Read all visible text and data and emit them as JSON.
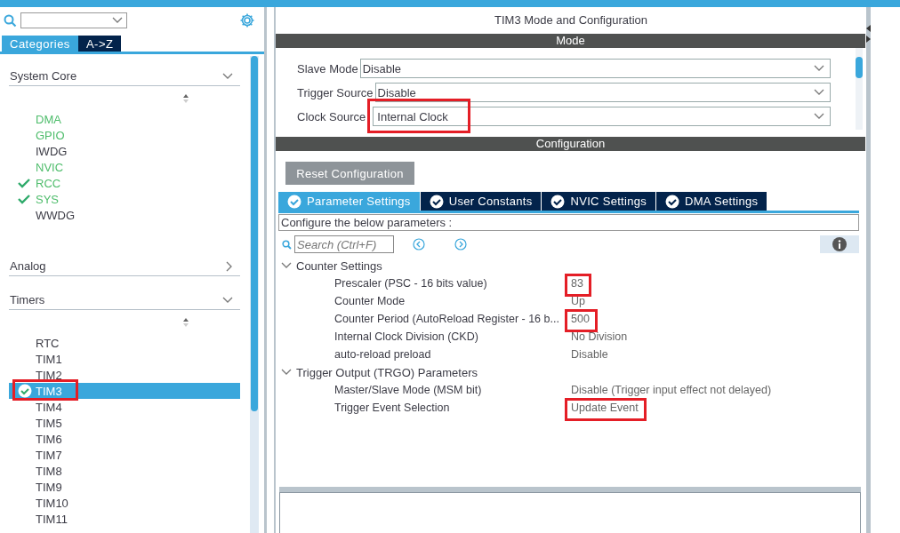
{
  "sidebar": {
    "view_tabs": [
      {
        "label": "Categories",
        "selected": true
      },
      {
        "label": "A->Z",
        "selected": false
      }
    ],
    "groups": [
      {
        "label": "System Core",
        "expanded": true,
        "items": [
          {
            "label": "DMA",
            "configured": true,
            "checked": false,
            "selected": false,
            "highlighted": false
          },
          {
            "label": "GPIO",
            "configured": true,
            "checked": false,
            "selected": false,
            "highlighted": false
          },
          {
            "label": "IWDG",
            "configured": false,
            "checked": false,
            "selected": false,
            "highlighted": false
          },
          {
            "label": "NVIC",
            "configured": true,
            "checked": false,
            "selected": false,
            "highlighted": false
          },
          {
            "label": "RCC",
            "configured": true,
            "checked": true,
            "selected": false,
            "highlighted": false
          },
          {
            "label": "SYS",
            "configured": true,
            "checked": true,
            "selected": false,
            "highlighted": false
          },
          {
            "label": "WWDG",
            "configured": false,
            "checked": false,
            "selected": false,
            "highlighted": false
          }
        ]
      },
      {
        "label": "Analog",
        "expanded": false
      },
      {
        "label": "Timers",
        "expanded": true,
        "items": [
          {
            "label": "RTC",
            "configured": false,
            "checked": false,
            "selected": false,
            "highlighted": false
          },
          {
            "label": "TIM1",
            "configured": false,
            "checked": false,
            "selected": false,
            "highlighted": false
          },
          {
            "label": "TIM2",
            "configured": false,
            "checked": false,
            "selected": false,
            "highlighted": false
          },
          {
            "label": "TIM3",
            "configured": false,
            "checked": true,
            "selected": true,
            "highlighted": true
          },
          {
            "label": "TIM4",
            "configured": false,
            "checked": false,
            "selected": false,
            "highlighted": false
          },
          {
            "label": "TIM5",
            "configured": false,
            "checked": false,
            "selected": false,
            "highlighted": false
          },
          {
            "label": "TIM6",
            "configured": false,
            "checked": false,
            "selected": false,
            "highlighted": false
          },
          {
            "label": "TIM7",
            "configured": false,
            "checked": false,
            "selected": false,
            "highlighted": false
          },
          {
            "label": "TIM8",
            "configured": false,
            "checked": false,
            "selected": false,
            "highlighted": false
          },
          {
            "label": "TIM9",
            "configured": false,
            "checked": false,
            "selected": false,
            "highlighted": false
          },
          {
            "label": "TIM10",
            "configured": false,
            "checked": false,
            "selected": false,
            "highlighted": false
          },
          {
            "label": "TIM11",
            "configured": false,
            "checked": false,
            "selected": false,
            "highlighted": false
          }
        ]
      }
    ]
  },
  "panel": {
    "title": "TIM3 Mode and Configuration",
    "mode": {
      "header": "Mode",
      "fields": [
        {
          "label": "Slave Mode",
          "value": "Disable",
          "highlighted": false
        },
        {
          "label": "Trigger Source",
          "value": "Disable",
          "highlighted": false
        },
        {
          "label": "Clock Source",
          "value": "Internal Clock",
          "highlighted": true
        }
      ]
    },
    "configuration": {
      "header": "Configuration",
      "reset_button": "Reset Configuration",
      "tabs": [
        {
          "label": "Parameter Settings",
          "selected": true
        },
        {
          "label": "User Constants",
          "selected": false
        },
        {
          "label": "NVIC Settings",
          "selected": false
        },
        {
          "label": "DMA Settings",
          "selected": false
        }
      ],
      "hint": "Configure the below parameters :",
      "search": {
        "placeholder": "Search (Ctrl+F)"
      },
      "groups": [
        {
          "label": "Counter Settings",
          "expanded": true,
          "children": [
            {
              "label": "Prescaler (PSC - 16 bits value)",
              "value": "83",
              "highlighted": true
            },
            {
              "label": "Counter Mode",
              "value": "Up",
              "highlighted": false
            },
            {
              "label": "Counter Period (AutoReload Register - 16 b...",
              "value": "500",
              "highlighted": true
            },
            {
              "label": "Internal Clock Division (CKD)",
              "value": "No Division",
              "highlighted": false
            },
            {
              "label": "auto-reload preload",
              "value": "Disable",
              "highlighted": false
            }
          ]
        },
        {
          "label": "Trigger Output (TRGO) Parameters",
          "expanded": true,
          "children": [
            {
              "label": "Master/Slave Mode (MSM bit)",
              "value": "Disable (Trigger input effect not delayed)",
              "highlighted": false
            },
            {
              "label": "Trigger Event Selection",
              "value": "Update Event",
              "highlighted": true
            }
          ]
        }
      ]
    }
  }
}
